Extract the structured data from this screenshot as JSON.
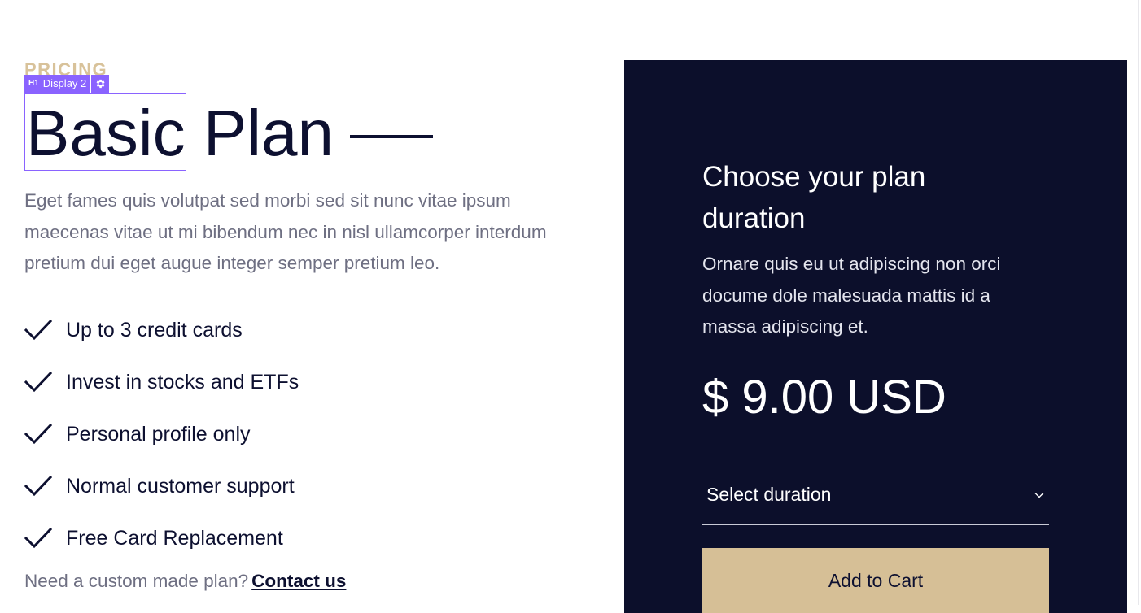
{
  "editor_overlay": {
    "heading_level": "H1",
    "style_name": "Display 2",
    "settings_icon": "gear-icon"
  },
  "pricing": {
    "eyebrow": "PRICING",
    "title": "Basic Plan",
    "description": "Eget fames quis volutpat sed morbi sed sit nunc vitae ipsum maecenas vitae ut mi bibendum nec in nisl ullamcorper interdum pretium dui eget augue integer semper pretium leo.",
    "features": [
      {
        "label": "Up to 3 credit cards",
        "icon": "check-icon"
      },
      {
        "label": "Invest in stocks and ETFs",
        "icon": "check-icon"
      },
      {
        "label": "Personal profile only",
        "icon": "check-icon"
      },
      {
        "label": "Normal customer support",
        "icon": "check-icon"
      },
      {
        "label": "Free Card Replacement",
        "icon": "check-icon"
      }
    ],
    "custom_plan_text": "Need a custom made plan?",
    "contact_link": "Contact us"
  },
  "card": {
    "heading": "Choose your plan duration",
    "description": "Ornare quis eu ut adipiscing non orci docume dole malesuada mattis id a massa adipiscing et.",
    "price": "$ 9.00 USD",
    "duration_select": {
      "value": "Select duration",
      "icon": "chevron-down-icon"
    },
    "add_to_cart_label": "Add to Cart"
  },
  "colors": {
    "navy": "#0c0f2b",
    "gold": "#d6bf96",
    "eyebrow_gold": "#d8c29a",
    "muted_text": "#6e6f82",
    "editor_purple": "#8a63ff"
  }
}
